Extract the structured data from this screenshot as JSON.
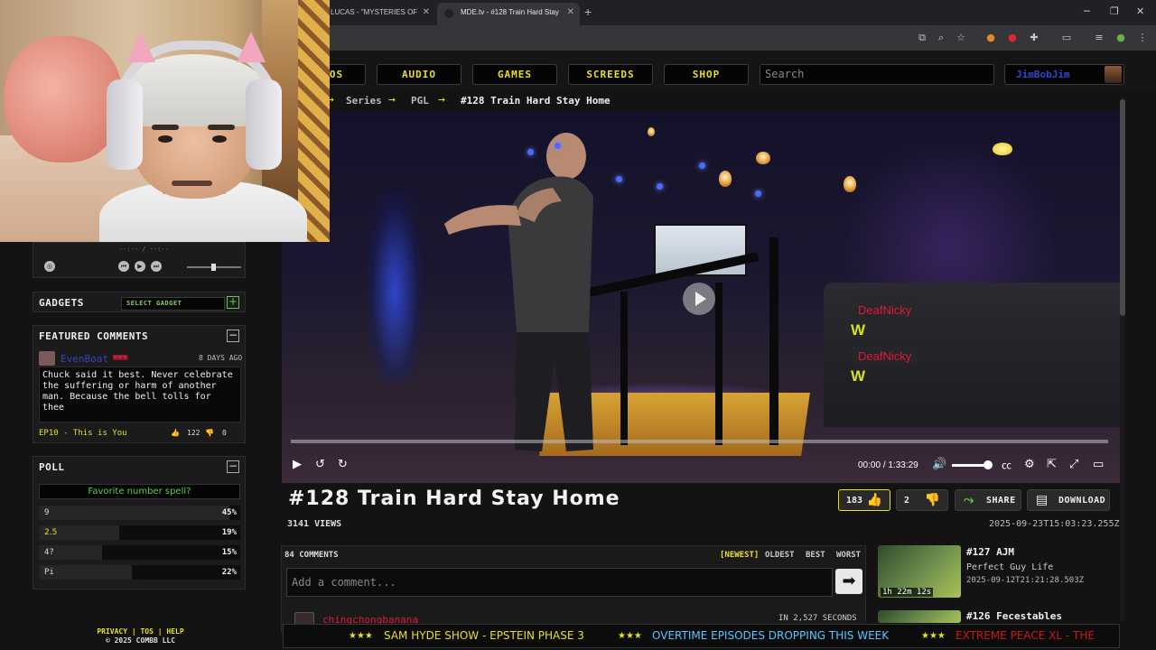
{
  "browser": {
    "tabs": [
      {
        "label": "LUCAS - \"MYSTERIES OF"
      },
      {
        "label": "MDE.tv - #128 Train Hard Stay"
      }
    ],
    "window": {
      "minimize": "─",
      "restore": "❐",
      "close": "✕"
    }
  },
  "nav": {
    "items": [
      {
        "label": "OS"
      },
      {
        "label": "AUDIO"
      },
      {
        "label": "GAMES"
      },
      {
        "label": "SCREEDS"
      },
      {
        "label": "SHOP"
      }
    ],
    "search_placeholder": "Search",
    "username": "JimBobJim"
  },
  "breadcrumb": {
    "items": [
      "Series",
      "PGL"
    ],
    "current": "#128 Train Hard Stay Home"
  },
  "video": {
    "title": "#128 Train Hard Stay Home",
    "views": "3141 VIEWS",
    "date": "2025-09-23T15:03:23.255Z",
    "current_time": "00:00",
    "separator": "/",
    "duration": "1:33:29",
    "progress": 0,
    "volume": 0.85,
    "likes": "183",
    "dislikes": "2",
    "share_label": "SHARE",
    "download_label": "DOWNLOAD",
    "chat": [
      {
        "user": "DeafNicky",
        "message": "W"
      },
      {
        "user": "DeafNicky",
        "message": "W"
      }
    ]
  },
  "comments": {
    "count_label": "84 COMMENTS",
    "sort": [
      {
        "label": "[NEWEST]",
        "active": true
      },
      {
        "label": "OLDEST",
        "active": false
      },
      {
        "label": "BEST",
        "active": false
      },
      {
        "label": "WORST",
        "active": false
      }
    ],
    "placeholder": "Add a comment...",
    "first": {
      "user": "chingchongbanana",
      "time": "IN 2,527 SECONDS"
    }
  },
  "related": [
    {
      "title": "#127 AJM",
      "subtitle": "Perfect Guy Life",
      "date": "2025-09-12T21:21:28.503Z",
      "duration": "1h 22m 12s"
    },
    {
      "title": "#126 Fecestables",
      "subtitle": "",
      "date": "",
      "duration": ""
    }
  ],
  "ticker": {
    "star": "★★★",
    "items": [
      {
        "text": "SAM HYDE SHOW - EPSTEIN PHASE 3",
        "color": "yellow"
      },
      {
        "text": "OVERTIME EPISODES DROPPING THIS WEEK",
        "color": "cyan"
      },
      {
        "text": "EXTREME PEACE XL - THE",
        "color": "red"
      }
    ]
  },
  "left": {
    "mini_player": {
      "time": "--:-- / --:--"
    },
    "gadgets": {
      "title": "GADGETS",
      "select_label": "SELECT GADGET",
      "add": "+"
    },
    "featured": {
      "title": "FEATURED COMMENTS",
      "toggle": "−",
      "user": "EvenBoat",
      "when": "8 DAYS AGO",
      "body": "Chuck said it best. Never celebrate the suffering or harm of another man. Because the bell tolls for thee",
      "episode": "EP10 - This is You",
      "likes": "122",
      "dislikes": "0"
    },
    "poll": {
      "title": "POLL",
      "toggle": "−",
      "question": "Favorite number spell?",
      "options": [
        {
          "label": "9",
          "pct": "45%",
          "value": 45,
          "leading": false
        },
        {
          "label": "2.5",
          "pct": "19%",
          "value": 19,
          "leading": true
        },
        {
          "label": "4?",
          "pct": "15%",
          "value": 15,
          "leading": false
        },
        {
          "label": "Pi",
          "pct": "22%",
          "value": 22,
          "leading": false
        }
      ]
    },
    "footer": {
      "links": "PRIVACY | TOS | HELP",
      "copyright": "© 2025 COMBB LLC"
    }
  },
  "colors": {
    "accent": "#e8df2d",
    "chat_name": "#e0183a",
    "username": "#3344cc",
    "green": "#66c24f"
  }
}
